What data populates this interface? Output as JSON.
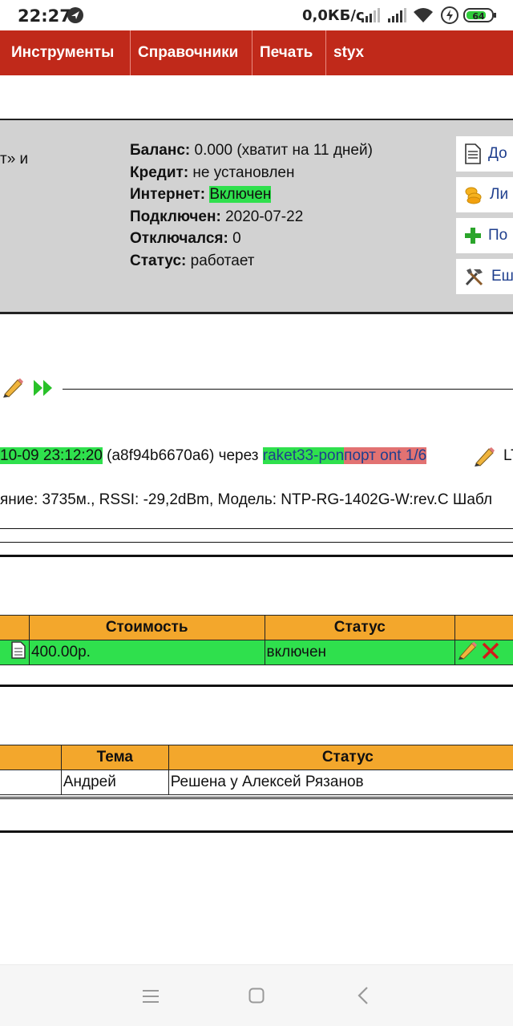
{
  "statusbar": {
    "time": "22:27",
    "speed": "0,0КБ/с",
    "battery": "64",
    "icons": [
      "navigation-icon",
      "signal-icon",
      "signal-icon",
      "wifi-icon",
      "charging-icon",
      "battery-icon"
    ]
  },
  "menu": {
    "items": [
      "Инструменты",
      "Справочники",
      "Печать",
      "styx"
    ]
  },
  "panel": {
    "left_text": "т» и",
    "balance_label": "Баланс:",
    "balance_value": " 0.000 (хватит на 11 дней)",
    "credit_label": "Кредит:",
    "credit_value": " не установлен",
    "internet_label": "Интернет:",
    "internet_value": "Включен",
    "connected_label": "Подключен:",
    "connected_value": " 2020-07-22",
    "disconnected_label": "Отключался:",
    "disconnected_value": " 0",
    "status_label": "Статус:",
    "status_value": " работает",
    "side_buttons": [
      "До",
      "Ли",
      "По",
      "Еш"
    ]
  },
  "session": {
    "datetime": "10-09 23:12:20",
    "mac": " (a8f94b6670a6) через ",
    "device": "raket33-pon",
    "port": "порт ont 1/6",
    "suffix": "LT",
    "details": "яние: 3735м., RSSI: -29,2dBm, Модель: NTP-RG-1402G-W:rev.C Шабл"
  },
  "tariffs": {
    "headers": [
      "Стоимость",
      "Статус"
    ],
    "row": {
      "cost": "400.00р.",
      "status": "включен"
    }
  },
  "tickets": {
    "headers": [
      "Тема",
      "Статус"
    ],
    "row": {
      "topic": "Андрей",
      "status": "Решена у Алексей Рязанов"
    }
  },
  "colors": {
    "menu": "#c0291a",
    "highlight_green": "#2fe04d",
    "highlight_red": "#e27272",
    "table_header": "#f3a72c",
    "panel_bg": "#d2d2d2"
  }
}
